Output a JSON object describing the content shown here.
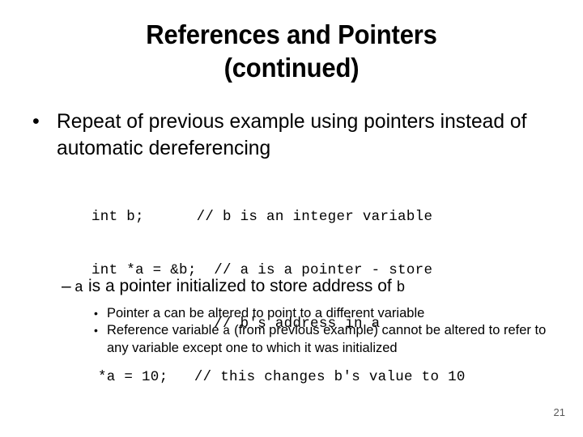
{
  "slide": {
    "title_line_1": "References and Pointers",
    "title_line_2": "(continued)",
    "background_color": "#ffffff",
    "text_color": "#000000"
  },
  "bullet_level_1": {
    "marker": "•",
    "text": "Repeat of previous example using pointers instead of automatic dereferencing"
  },
  "code_block": {
    "lines": [
      "int b;      // b is an integer variable",
      "int *a = &b;  // a is a pointer - store",
      "              // b's address in a",
      "*a = 10;   // this changes b's value to 10"
    ],
    "line_1": "int b;      // b is an integer variable",
    "line_2": "int *a = &b;  // a is a pointer - store",
    "line_3": "              // b's address in a",
    "line_4": "*a = 10;   // this changes b's value to 10"
  },
  "bullet_level_2": {
    "marker": "–",
    "var_a": "a",
    "text_middle": " is a pointer initialized to store address of ",
    "var_b": "b"
  },
  "bullet_level_3": {
    "marker": "•",
    "items": [
      {
        "text": "Pointer a can be altered to point to a different variable"
      },
      {
        "text_before": "Reference variable ",
        "var": "a",
        "text_after": " (from previous example) cannot be altered to refer to any variable except one to which it was initialized"
      }
    ]
  },
  "footer": {
    "page_number": "21"
  }
}
